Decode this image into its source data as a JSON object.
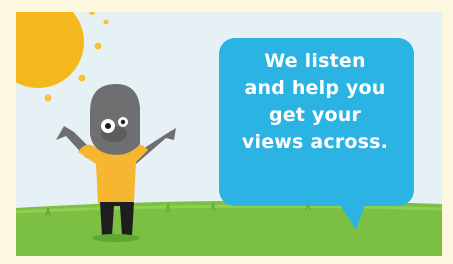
{
  "speech_bubble": {
    "lines": [
      "We listen",
      "and help you",
      "get your",
      "views across."
    ]
  },
  "colors": {
    "page_background": "#fdf7df",
    "sky": "#e6f1f6",
    "sun": "#f5b81c",
    "grass": "#7cc043",
    "bubble": "#2bb3e3",
    "character_shirt": "#f6b630",
    "character_head": "#6f6f71"
  },
  "icons": [
    "sun-icon",
    "speech-bubble",
    "cartoon-character"
  ]
}
